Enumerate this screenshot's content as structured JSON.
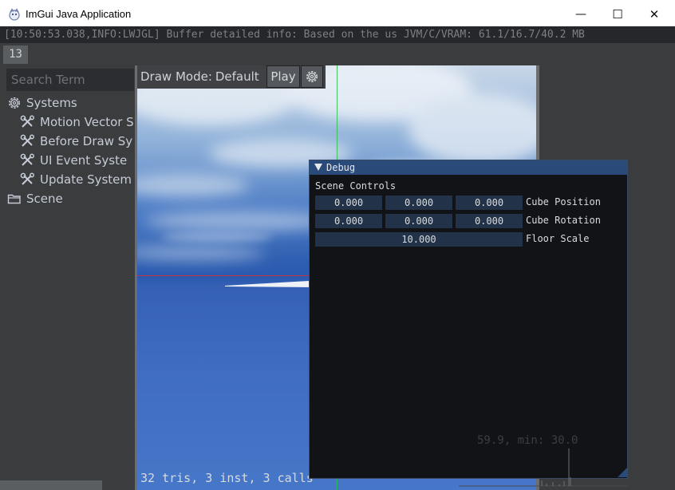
{
  "window": {
    "title": "ImGui Java Application",
    "minimize_glyph": "—",
    "maximize_glyph": "☐",
    "close_glyph": "✕"
  },
  "log": {
    "line": "[10:50:53.038,INFO:LWJGL] Buffer detailed info: Based on the us  JVM/C/VRAM: 61.1/16.7/40.2 MB"
  },
  "tab_counter": "13",
  "sidebar": {
    "search_placeholder": "Search Term",
    "items": [
      {
        "label": "Systems",
        "icon": "gear-icon"
      },
      {
        "label": "Motion Vector S",
        "icon": "tools-icon"
      },
      {
        "label": "Before Draw Sy",
        "icon": "tools-icon"
      },
      {
        "label": "UI Event Syste",
        "icon": "tools-icon"
      },
      {
        "label": "Update System",
        "icon": "tools-icon"
      },
      {
        "label": "Scene",
        "icon": "folder-icon"
      }
    ]
  },
  "viewport": {
    "draw_mode_label": "Draw Mode:",
    "draw_mode_value": "Default",
    "play_label": "Play",
    "stats": "32 tris, 3 inst, 3 calls",
    "perf_overlay": "59.9, min: 30.0"
  },
  "debug": {
    "title": "Debug",
    "section": "Scene Controls",
    "cube_position": {
      "label": "Cube Position",
      "values": [
        "0.000",
        "0.000",
        "0.000"
      ]
    },
    "cube_rotation": {
      "label": "Cube Rotation",
      "values": [
        "0.000",
        "0.000",
        "0.000"
      ]
    },
    "floor_scale": {
      "label": "Floor Scale",
      "value": "10.000"
    }
  },
  "colors": {
    "accent": "#2a4a7a",
    "field_bg": "#223248",
    "panel_bg": "#3a3c3e",
    "x_axis": "#d53030",
    "y_axis": "#2cc14a"
  }
}
